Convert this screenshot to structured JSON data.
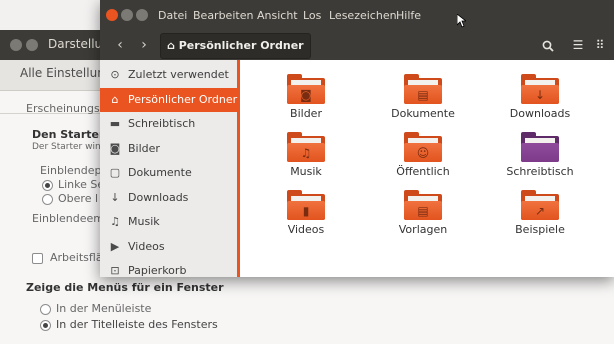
{
  "background_window": {
    "title": "Darstellu",
    "back_link": "Alle Einstellung",
    "section_tab": "Erscheinungsb",
    "launcher_heading": "Den Starter",
    "launcher_desc": "Der Starter win",
    "reveal_label": "Einblendepo",
    "radio_left": "Linke Se",
    "radio_top": "Obere l",
    "sensitivity_label": "Einblendeem",
    "workspaces_label": "Arbeitsflä",
    "menus_heading": "Zeige die Menüs für ein Fenster",
    "menus_option_menubar": "In der Menüleiste",
    "menus_option_titlebar": "In der Titelleiste des Fensters"
  },
  "file_manager": {
    "menu": [
      "Datei",
      "Bearbeiten",
      "Ansicht",
      "Los",
      "Lesezeichen",
      "Hilfe"
    ],
    "path_button": "Persönlicher Ordner",
    "sidebar": [
      {
        "label": "Zuletzt verwendet",
        "icon": "clock-icon",
        "glyph": "⊙",
        "active": false
      },
      {
        "label": "Persönlicher Ordner",
        "icon": "home-icon",
        "glyph": "⌂",
        "active": true
      },
      {
        "label": "Schreibtisch",
        "icon": "desktop-icon",
        "glyph": "▬",
        "active": false
      },
      {
        "label": "Bilder",
        "icon": "camera-icon",
        "glyph": "◙",
        "active": false
      },
      {
        "label": "Dokumente",
        "icon": "document-icon",
        "glyph": "▢",
        "active": false
      },
      {
        "label": "Downloads",
        "icon": "download-icon",
        "glyph": "↓",
        "active": false
      },
      {
        "label": "Musik",
        "icon": "music-icon",
        "glyph": "♫",
        "active": false
      },
      {
        "label": "Videos",
        "icon": "video-icon",
        "glyph": "▶",
        "active": false
      },
      {
        "label": "Papierkorb",
        "icon": "trash-icon",
        "glyph": "⊡",
        "active": false
      }
    ],
    "folders": [
      {
        "label": "Bilder",
        "icon": "pictures-folder-icon",
        "emblem": "◙"
      },
      {
        "label": "Dokumente",
        "icon": "documents-folder-icon",
        "emblem": "▤"
      },
      {
        "label": "Downloads",
        "icon": "downloads-folder-icon",
        "emblem": "↓"
      },
      {
        "label": "Musik",
        "icon": "music-folder-icon",
        "emblem": "♫"
      },
      {
        "label": "Öffentlich",
        "icon": "public-folder-icon",
        "emblem": "☺"
      },
      {
        "label": "Schreibtisch",
        "icon": "desktop-folder-icon",
        "emblem": ""
      },
      {
        "label": "Videos",
        "icon": "videos-folder-icon",
        "emblem": "▮"
      },
      {
        "label": "Vorlagen",
        "icon": "templates-folder-icon",
        "emblem": "▤"
      },
      {
        "label": "Beispiele",
        "icon": "examples-folder-icon",
        "emblem": "↗"
      }
    ],
    "colors": {
      "accent": "#e95420",
      "titlebar": "#3c3b37",
      "close_button": "#e95420",
      "desktop_folder": "#7d3b8a"
    }
  }
}
